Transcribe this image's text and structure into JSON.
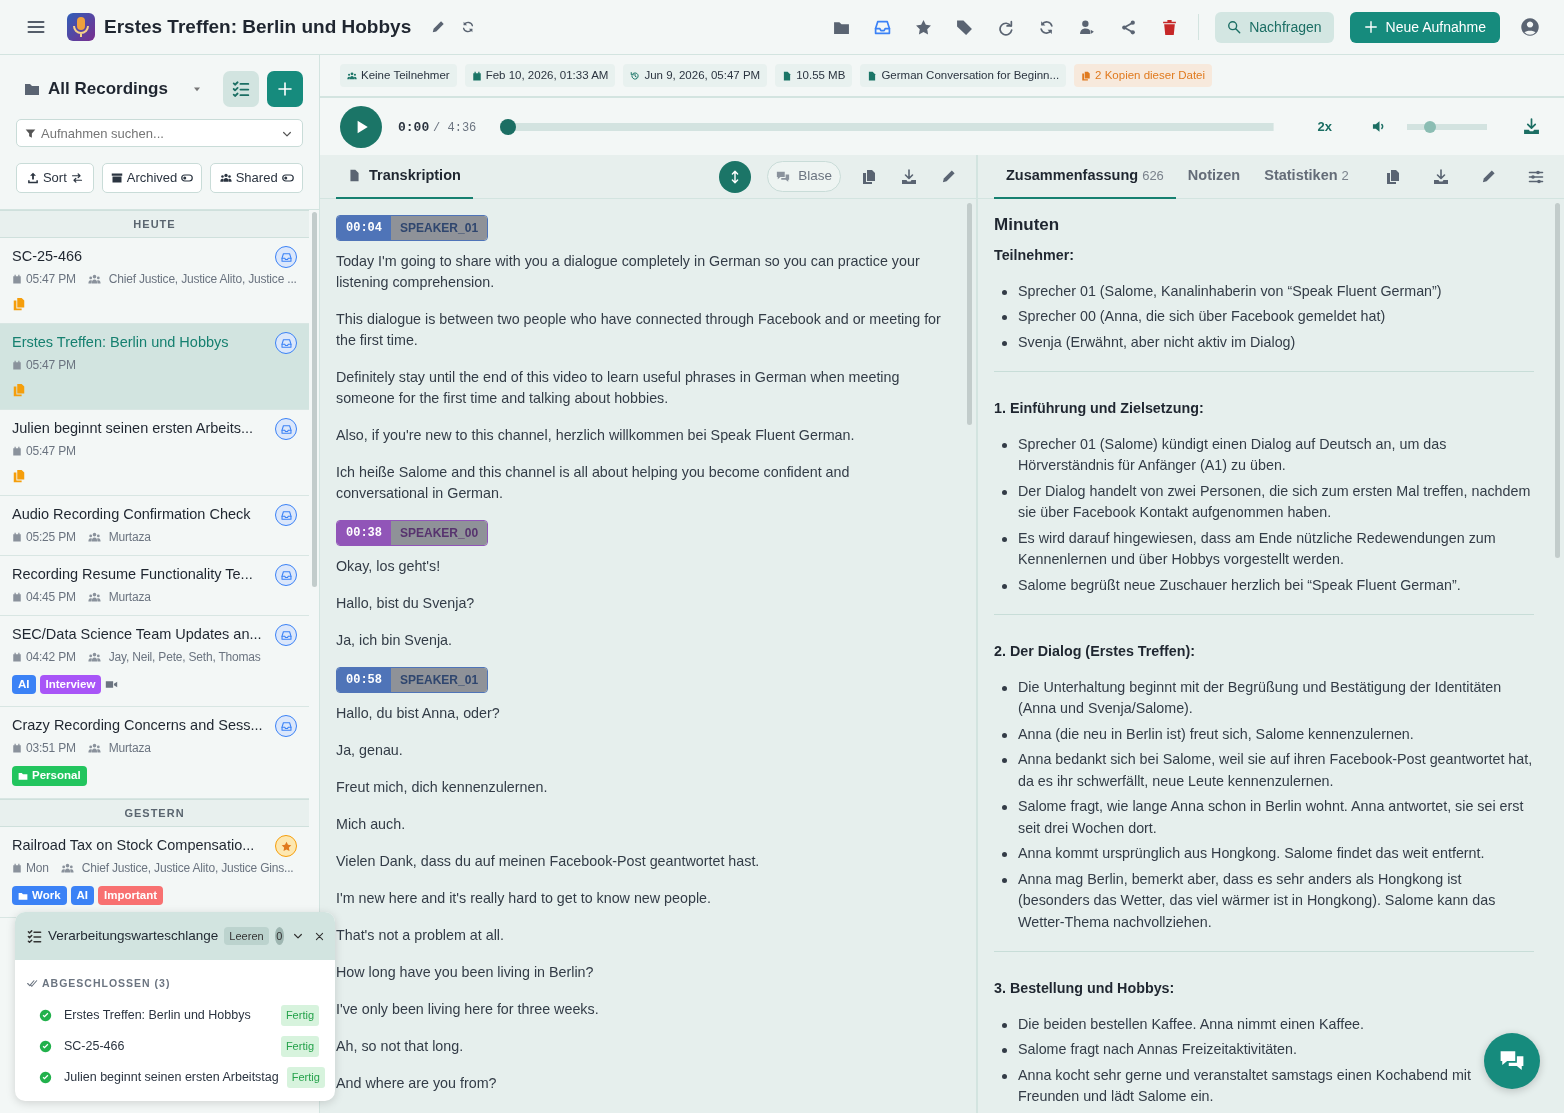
{
  "header": {
    "title": "Erstes Treffen: Berlin und Hobbys",
    "tools": [
      {
        "kind": "folder"
      },
      {
        "kind": "inbox"
      },
      {
        "kind": "star"
      },
      {
        "kind": "tags"
      },
      {
        "kind": "redo"
      },
      {
        "kind": "sync"
      },
      {
        "kind": "user-share"
      },
      {
        "kind": "share"
      },
      {
        "kind": "trash"
      }
    ],
    "ask_button": "Nachfragen",
    "new_button": "Neue Aufnahme"
  },
  "sidebar": {
    "title": "All Recordings",
    "search": {
      "placeholder": "Aufnahmen suchen..."
    },
    "filters": [
      {
        "kind": "sort",
        "label": "Sort"
      },
      {
        "kind": "toggle",
        "label": "Archived",
        "on": false
      },
      {
        "kind": "toggle",
        "label": "Shared",
        "on": false
      }
    ],
    "groups": [
      {
        "label": "HEUTE",
        "items": [
          {
            "title": "SC-25-466",
            "time": "05:47 PM",
            "participants": "Chief Justice, Justice Alito, Justice ...",
            "badge": {
              "kind": "inbox"
            },
            "copies": true,
            "selected": false
          },
          {
            "title": "Erstes Treffen: Berlin und Hobbys",
            "time": "05:47 PM",
            "badge": {
              "kind": "inbox"
            },
            "copies": true,
            "selected": true
          },
          {
            "title": "Julien beginnt seinen ersten Arbeits...",
            "time": "05:47 PM",
            "badge": {
              "kind": "inbox"
            },
            "copies": true,
            "selected": false
          },
          {
            "title": "Audio Recording Confirmation Check",
            "time": "05:25 PM",
            "participants": "Murtaza",
            "badge": {
              "kind": "inbox"
            },
            "selected": false
          },
          {
            "title": "Recording Resume Functionality Te...",
            "time": "04:45 PM",
            "participants": "Murtaza",
            "badge": {
              "kind": "inbox"
            },
            "selected": false
          },
          {
            "title": "SEC/Data Science Team Updates an...",
            "time": "04:42 PM",
            "participants": "Jay, Neil, Pete, Seth, Thomas",
            "badge": {
              "kind": "inbox"
            },
            "video": true,
            "tags": [
              {
                "label": "AI",
                "kind": "tag",
                "color": "#3b82f6"
              },
              {
                "label": "Interview",
                "kind": "tag",
                "color": "#a855f7"
              }
            ],
            "selected": false
          },
          {
            "title": "Crazy Recording Concerns and Sess...",
            "time": "03:51 PM",
            "participants": "Murtaza",
            "badge": {
              "kind": "inbox"
            },
            "tags": [
              {
                "label": "Personal",
                "kind": "folder",
                "color": "#22c55e"
              }
            ],
            "selected": false
          }
        ]
      },
      {
        "label": "GESTERN",
        "items": [
          {
            "title": "Railroad Tax on Stock Compensatio...",
            "time": "Mon",
            "participants": "Chief Justice, Justice Alito, Justice Gins...",
            "badge": {
              "kind": "star"
            },
            "tags": [
              {
                "label": "Work",
                "kind": "folder",
                "color": "#3b82f6"
              },
              {
                "label": "AI",
                "kind": "tag",
                "color": "#3b82f6"
              },
              {
                "label": "Important",
                "kind": "tag",
                "color": "#f87171"
              }
            ],
            "selected": false
          }
        ]
      }
    ]
  },
  "meta": [
    {
      "kind": "users",
      "text": "Keine Teilnehmer"
    },
    {
      "kind": "calendar",
      "text": "Feb 10, 2026, 01:33 AM"
    },
    {
      "kind": "history",
      "text": "Jun 9, 2026, 05:47 PM"
    },
    {
      "kind": "file",
      "text": "10.55 MB"
    },
    {
      "kind": "file",
      "text": "German Conversation for Beginn..."
    },
    {
      "kind": "copies",
      "text": "2 Kopien dieser Datei"
    }
  ],
  "player": {
    "current": "0:00",
    "duration": "/ 4:36",
    "level": 0,
    "speed": "2x",
    "volume": {
      "level": 0.25
    }
  },
  "transcript": {
    "tabs": [
      {
        "label": "Transkription",
        "selected": true
      }
    ],
    "bubble_label": "Blase",
    "segments": [
      {
        "time": "00:04",
        "speaker": "SPEAKER_01",
        "color": "#4f74b8",
        "lines": [
          "Today I'm going to share with you a dialogue completely in German so you can practice your listening comprehension.",
          "This dialogue is between two people who have connected through Facebook and or meeting for the first time.",
          "Definitely stay until the end of this video to learn useful phrases in German when meeting someone for the first time and talking about hobbies.",
          "Also, if you're new to this channel, herzlich willkommen bei Speak Fluent German.",
          "Ich heiße Salome and this channel is all about helping you become confident and conversational in German."
        ]
      },
      {
        "time": "00:38",
        "speaker": "SPEAKER_00",
        "color": "#9155b8",
        "lines": [
          "Okay, los geht's!",
          "Hallo, bist du Svenja?",
          "Ja, ich bin Svenja."
        ]
      },
      {
        "time": "00:58",
        "speaker": "SPEAKER_01",
        "color": "#4f74b8",
        "lines": [
          "Hallo, du bist Anna, oder?",
          "Ja, genau.",
          "Freut mich, dich kennenzulernen.",
          "Mich auch.",
          "Vielen Dank, dass du auf meinen Facebook-Post geantwortet hast.",
          "I'm new here and it's really hard to get to know new people.",
          "That's not a problem at all.",
          "How long have you been living in Berlin?",
          "I've only been living here for three weeks.",
          "Ah, so not that long.",
          "And where are you from?"
        ]
      }
    ]
  },
  "summary": {
    "tabs": [
      {
        "label": "Zusammenfassung",
        "count": "626",
        "selected": true
      },
      {
        "label": "Notizen",
        "selected": false
      },
      {
        "label": "Statistiken",
        "count": "2",
        "selected": false
      }
    ],
    "heading": "Minuten",
    "sections": [
      {
        "title": "Teilnehmer:",
        "bullets": [
          "Sprecher 01 (Salome, Kanalinhaberin von “Speak Fluent German”)",
          "Sprecher 00 (Anna, die sich über Facebook gemeldet hat)",
          "Svenja (Erwähnt, aber nicht aktiv im Dialog)"
        ]
      },
      {
        "title": "1. Einführung und Zielsetzung:",
        "bullets": [
          "Sprecher 01 (Salome) kündigt einen Dialog auf Deutsch an, um das Hörverständnis für Anfänger (A1) zu üben.",
          "Der Dialog handelt von zwei Personen, die sich zum ersten Mal treffen, nachdem sie über Facebook Kontakt aufgenommen haben.",
          "Es wird darauf hingewiesen, dass am Ende nützliche Redewendungen zum Kennenlernen und über Hobbys vorgestellt werden.",
          "Salome begrüßt neue Zuschauer herzlich bei “Speak Fluent German”."
        ]
      },
      {
        "title": "2. Der Dialog (Erstes Treffen):",
        "bullets": [
          "Die Unterhaltung beginnt mit der Begrüßung und Bestätigung der Identitäten (Anna und Svenja/Salome).",
          "Anna (die neu in Berlin ist) freut sich, Salome kennenzulernen.",
          "Anna bedankt sich bei Salome, weil sie auf ihren Facebook-Post geantwortet hat, da es ihr schwerfällt, neue Leute kennenzulernen.",
          "Salome fragt, wie lange Anna schon in Berlin wohnt. Anna antwortet, sie sei erst seit drei Wochen dort.",
          "Anna kommt ursprünglich aus Hongkong. Salome findet das weit entfernt.",
          "Anna mag Berlin, bemerkt aber, dass es sehr anders als Hongkong ist (besonders das Wetter, das viel wärmer ist in Hongkong). Salome kann das Wetter-Thema nachvollziehen."
        ]
      },
      {
        "title": "3. Bestellung und Hobbys:",
        "bullets": [
          "Die beiden bestellen Kaffee. Anna nimmt einen Kaffee.",
          "Salome fragt nach Annas Freizeitaktivitäten.",
          "Anna kocht sehr gerne und veranstaltet samstags einen Kochabend mit Freunden und lädt Salome ein."
        ]
      }
    ]
  },
  "queue": {
    "title": "Verarbeitungswarteschlange",
    "clear_label": "Leeren",
    "count": "0",
    "section": "ABGESCHLOSSEN (3)",
    "items": [
      {
        "name": "Erstes Treffen: Berlin und Hobbys",
        "status": "Fertig"
      },
      {
        "name": "SC-25-466",
        "status": "Fertig"
      },
      {
        "name": "Julien beginnt seinen ersten Arbeitstag",
        "status": "Fertig"
      }
    ]
  }
}
